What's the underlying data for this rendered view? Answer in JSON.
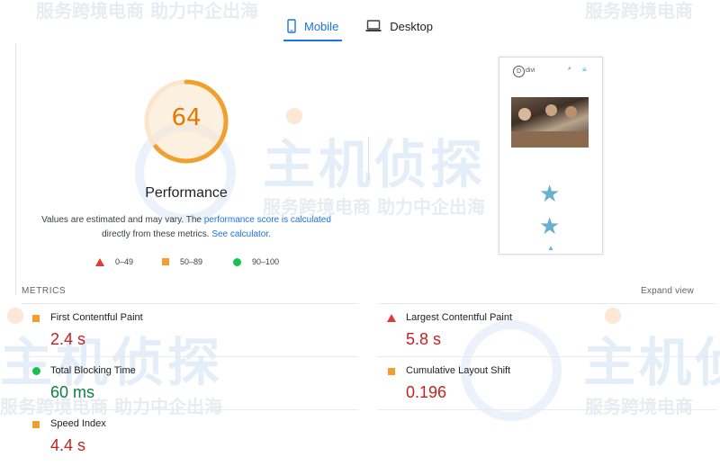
{
  "colors": {
    "accent": "#1a73e8",
    "average": "#f0a030",
    "fail": "#e53935",
    "pass": "#18c04f",
    "value_fail": "#c5221f",
    "value_pass": "#0d8043"
  },
  "tabs": [
    {
      "label": "Mobile",
      "icon": "phone-icon",
      "active": true
    },
    {
      "label": "Desktop",
      "icon": "laptop-icon",
      "active": false
    }
  ],
  "score": {
    "value": "64",
    "label": "Performance"
  },
  "description": {
    "text1": "Values are estimated and may vary. The ",
    "link1": "performance score is calculated",
    "text2": "directly from these metrics. ",
    "link2": "See calculator."
  },
  "legend": [
    {
      "icon": "red-triangle-icon",
      "range": "0–49"
    },
    {
      "icon": "orange-square-icon",
      "range": "50–89"
    },
    {
      "icon": "green-circle-icon",
      "range": "90–100"
    }
  ],
  "preview": {
    "logo": "D",
    "site_name": "divi",
    "search": "⌕",
    "menu": "≡"
  },
  "metrics": {
    "header": "METRICS",
    "expand": "Expand view",
    "items": [
      {
        "name": "First Contentful Paint",
        "value": "2.4 s",
        "status": "average"
      },
      {
        "name": "Largest Contentful Paint",
        "value": "5.8 s",
        "status": "fail"
      },
      {
        "name": "Total Blocking Time",
        "value": "60 ms",
        "status": "pass"
      },
      {
        "name": "Cumulative Layout Shift",
        "value": "0.196",
        "status": "average"
      },
      {
        "name": "Speed Index",
        "value": "4.4 s",
        "status": "average"
      }
    ]
  },
  "watermark": {
    "text": "服务跨境电商 助力中企出海",
    "short": "服务跨境电商",
    "brand": "主机侦探"
  }
}
